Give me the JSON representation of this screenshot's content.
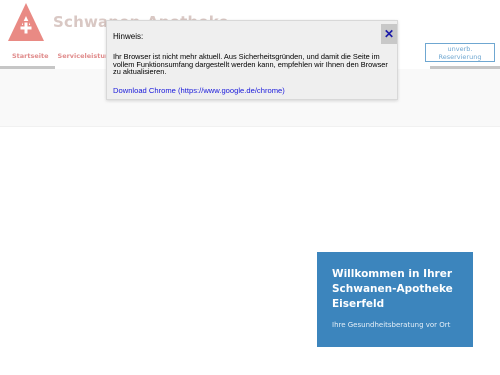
{
  "colors": {
    "brand_red": "#e98a84",
    "accent_blue": "#3c85bd",
    "link_blue": "#1a1adb"
  },
  "header": {
    "brand_name": "Schwanen-Apotheke",
    "logo_icon": "apotheke-a-logo-icon",
    "nav": [
      "Startseite",
      "Serviceleistung"
    ],
    "reserve_label": "unverb. Reservierung"
  },
  "dialog": {
    "title": "Hinweis:",
    "message": "Ihr Browser ist nicht mehr aktuell. Aus Sicherheitsgründen, und damit die Seite im vollem Funktionsumfang dargestellt werden kann, empfehlen wir Ihnen den Browser zu aktualisieren.",
    "link_text": "Download Chrome (https://www.google.de/chrome)",
    "close_label": "✕"
  },
  "welcome": {
    "title": "Willkommen in Ihrer Schwanen-Apotheke Eiserfeld",
    "subtitle": "Ihre Gesundheitsberatung vor Ort"
  }
}
